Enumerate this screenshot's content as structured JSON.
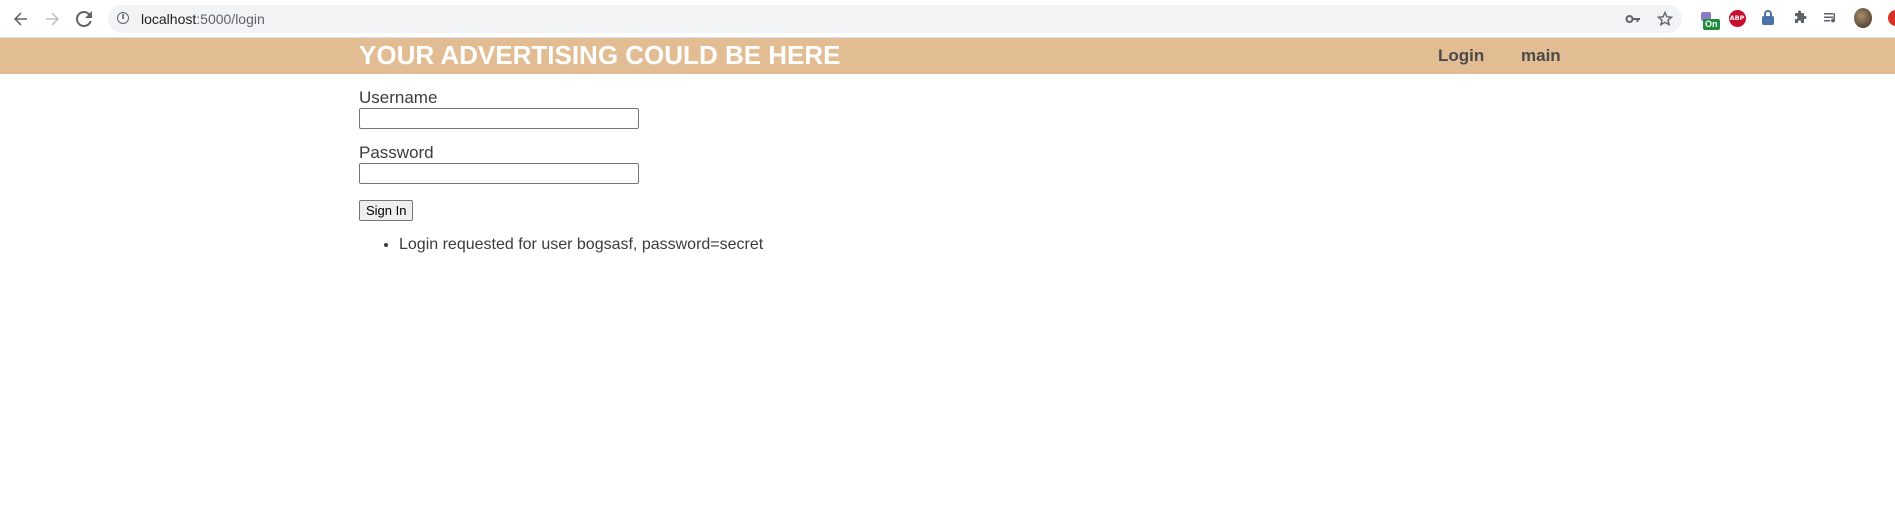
{
  "browser": {
    "url_host": "localhost",
    "url_path": ":5000/login",
    "icons": {
      "back": "back-arrow-icon",
      "forward": "forward-arrow-icon",
      "reload": "reload-icon",
      "info": "site-info-icon",
      "key": "password-key-icon",
      "star": "bookmark-star-icon"
    },
    "extensions": {
      "badge_text": "On",
      "abp_text": "ABP"
    }
  },
  "header": {
    "title": "YOUR ADVERTISING COULD BE HERE",
    "nav": [
      {
        "label": "Login"
      },
      {
        "label": "main"
      }
    ],
    "background_color": "#e2bd93"
  },
  "form": {
    "username_label": "Username",
    "username_value": "",
    "password_label": "Password",
    "password_value": "",
    "submit_label": "Sign In"
  },
  "messages": [
    "Login requested for user bogsasf, password=secret"
  ]
}
